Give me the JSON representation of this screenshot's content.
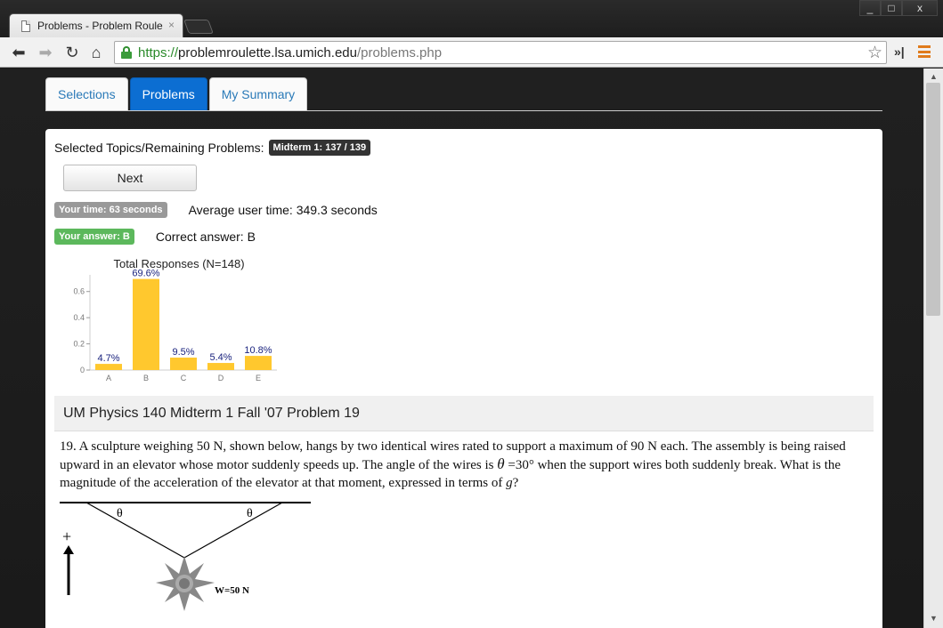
{
  "browser": {
    "tab_title": "Problems - Problem Roule",
    "tab_close": "×",
    "window_min": "_",
    "window_max": "□",
    "window_close": "x",
    "url_scheme": "https://",
    "url_host": "problemroulette.lsa.umich.edu",
    "url_path": "/problems.php",
    "extension_label": "»|"
  },
  "nav": {
    "tabs": [
      {
        "label": "Selections",
        "active": false
      },
      {
        "label": "Problems",
        "active": true
      },
      {
        "label": "My Summary",
        "active": false
      }
    ]
  },
  "status": {
    "selected_label": "Selected Topics/Remaining Problems:",
    "topic_badge": "Midterm 1:  137 / 139",
    "next_label": "Next",
    "your_time_badge": "Your time:  63 seconds",
    "average_time": "Average user time: 349.3 seconds",
    "your_answer_badge": "Your answer:  B",
    "correct_answer": "Correct answer: B"
  },
  "chart_data": {
    "type": "bar",
    "title": "Total Responses (N=148)",
    "categories": [
      "A",
      "B",
      "C",
      "D",
      "E"
    ],
    "values": [
      0.047,
      0.696,
      0.095,
      0.054,
      0.108
    ],
    "data_labels": [
      "4.7%",
      "69.6%",
      "9.5%",
      "5.4%",
      "10.8%"
    ],
    "yticks": [
      "0",
      "0.2",
      "0.4",
      "0.6"
    ],
    "ylim": [
      0,
      0.7
    ],
    "bar_color": "#ffc82e",
    "label_color": "#1a237e"
  },
  "problem": {
    "header": "UM Physics 140 Midterm 1 Fall '07 Problem 19",
    "text_1": "19.  A sculpture weighing 50 N, shown below, hangs by two identical wires rated to support a maximum of 90 N each.  The assembly is being raised upward in an elevator whose motor suddenly speeds up.  The angle of the wires is ",
    "theta": "θ",
    "text_2": " =30° when the support wires both suddenly break.  What is the magnitude of the acceleration of the elevator at that moment, expressed in terms of ",
    "g": "g",
    "text_3": "?",
    "figure": {
      "angle_left": "θ",
      "angle_right": "θ",
      "plus": "+",
      "weight_label": "W=50 N"
    }
  }
}
